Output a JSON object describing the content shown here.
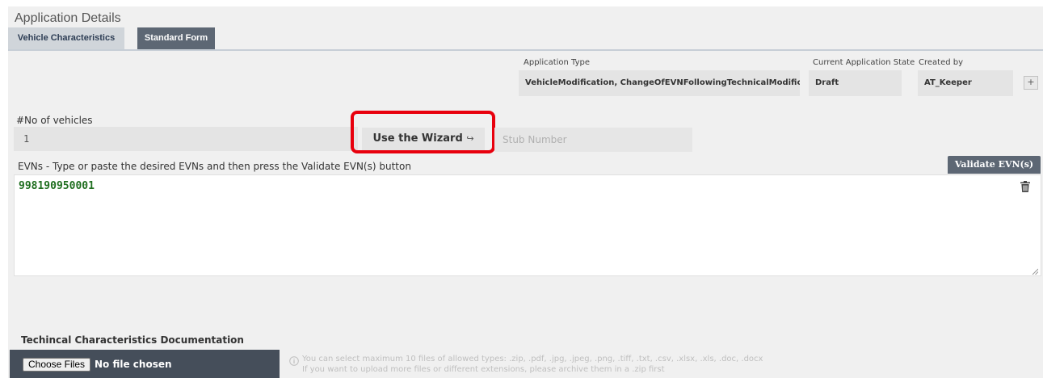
{
  "header": {
    "title": "Application Details",
    "tabs": [
      {
        "label": "Vehicle Characteristics"
      },
      {
        "label": "Standard Form"
      }
    ]
  },
  "summary": {
    "application_type_label": "Application Type",
    "application_type_value": "VehicleModification, ChangeOfEVNFollowingTechnicalModific",
    "state_label": "Current Application State",
    "state_value": "Draft",
    "created_by_label": "Created by",
    "created_by_value": "AT_Keeper",
    "plus_label": "+"
  },
  "vehicles": {
    "label": "#No of vehicles",
    "value": "1",
    "wizard_label": "Use the Wizard",
    "wizard_arrow": "↪",
    "stub_placeholder": "Stub Number"
  },
  "evn": {
    "instructions": "EVNs - Type or paste the desired EVNs and then press the Validate EVN(s) button",
    "validate_label": "Validate EVN(s)",
    "value": "998190950001"
  },
  "documentation": {
    "title": "Techincal Characteristics Documentation",
    "choose_label": "Choose Files",
    "no_file": "No file chosen",
    "hint_line1": "You can select maximum 10 files of allowed types: .zip, .pdf, .jpg, .jpeg, .png, .tiff, .txt, .csv, .xlsx, .xls, .doc, .docx",
    "hint_line2": "If you want to upload more files or different extensions, please archive them in a .zip first"
  },
  "colors": {
    "accent_dark": "#5d6774",
    "highlight": "#e8000d",
    "evn_green": "#1f6e1f"
  },
  "icons": [
    "trash-icon",
    "info-icon",
    "resize-handle-icon"
  ]
}
